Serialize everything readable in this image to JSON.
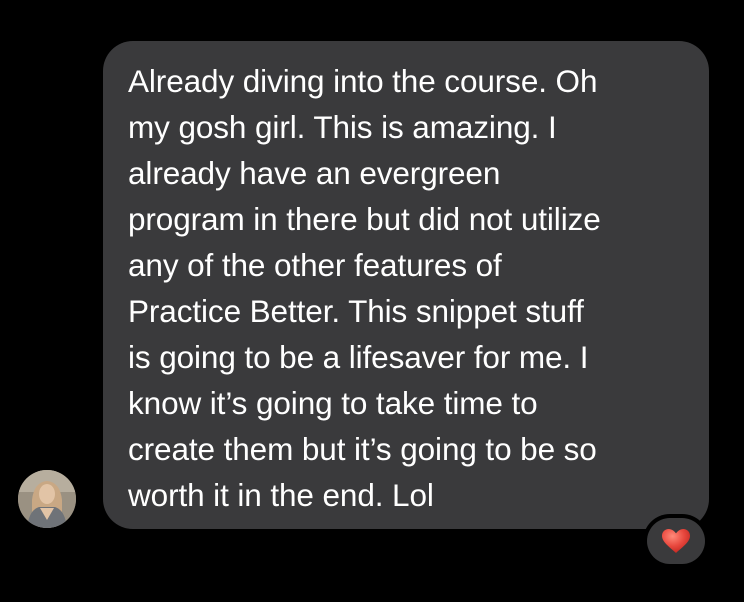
{
  "message": {
    "lines": [
      "Already diving into the course. Oh",
      "my gosh girl. This is amazing. I",
      "already have an evergreen",
      "program in there but did not utilize",
      "any of the other features of",
      "Practice Better. This snippet stuff",
      "is going to be a lifesaver for me. I",
      "know it’s going to take time to",
      "create them but it’s going to be so",
      "worth it in the end.  Lol"
    ]
  },
  "sender": {
    "avatar_icon": "person-photo-icon"
  },
  "reaction": {
    "icon": "red-heart-icon",
    "color": "#e8483e"
  },
  "colors": {
    "background": "#000000",
    "bubble": "#3a3a3c",
    "text": "#ffffff"
  }
}
